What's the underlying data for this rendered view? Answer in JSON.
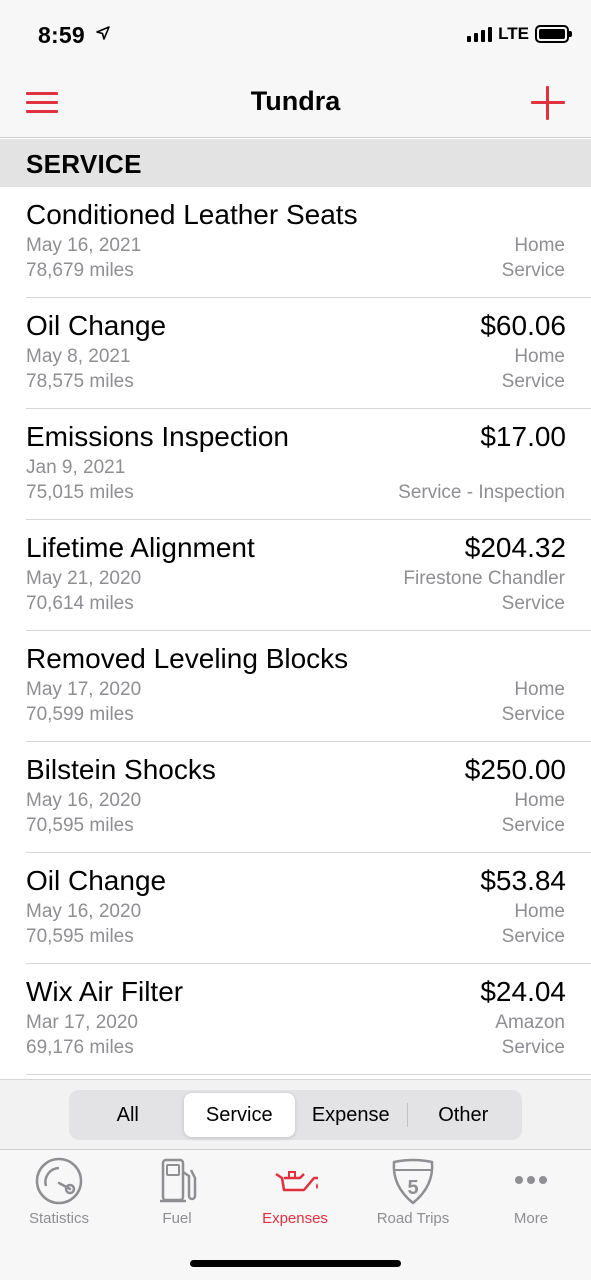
{
  "status_bar": {
    "time": "8:59",
    "network": "LTE"
  },
  "nav": {
    "title": "Tundra",
    "menu_icon": "hamburger-menu-icon",
    "add_icon": "plus-icon",
    "accent_color": "#e0313f"
  },
  "section": {
    "title": "SERVICE"
  },
  "entries": [
    {
      "title": "Conditioned Leather Seats",
      "date": "May 16, 2021",
      "miles": "78,679 miles",
      "amount": "",
      "location": "Home",
      "type": "Service"
    },
    {
      "title": "Oil Change",
      "date": "May 8, 2021",
      "miles": "78,575 miles",
      "amount": "$60.06",
      "location": "Home",
      "type": "Service"
    },
    {
      "title": "Emissions Inspection",
      "date": "Jan 9, 2021",
      "miles": "75,015 miles",
      "amount": "$17.00",
      "location": "",
      "type": "Service - Inspection"
    },
    {
      "title": "Lifetime Alignment",
      "date": "May 21, 2020",
      "miles": "70,614 miles",
      "amount": "$204.32",
      "location": "Firestone Chandler",
      "type": "Service"
    },
    {
      "title": "Removed Leveling Blocks",
      "date": "May 17, 2020",
      "miles": "70,599 miles",
      "amount": "",
      "location": "Home",
      "type": "Service"
    },
    {
      "title": "Bilstein Shocks",
      "date": "May 16, 2020",
      "miles": "70,595 miles",
      "amount": "$250.00",
      "location": "Home",
      "type": "Service"
    },
    {
      "title": "Oil Change",
      "date": "May 16, 2020",
      "miles": "70,595 miles",
      "amount": "$53.84",
      "location": "Home",
      "type": "Service"
    },
    {
      "title": "Wix Air Filter",
      "date": "Mar 17, 2020",
      "miles": "69,176 miles",
      "amount": "$24.04",
      "location": "Amazon",
      "type": "Service"
    }
  ],
  "segments": {
    "items": [
      "All",
      "Service",
      "Expense",
      "Other"
    ],
    "selected": "Service"
  },
  "tabs": [
    {
      "label": "Statistics",
      "icon": "gauge-icon",
      "active": false
    },
    {
      "label": "Fuel",
      "icon": "fuel-pump-icon",
      "active": false
    },
    {
      "label": "Expenses",
      "icon": "oil-can-icon",
      "active": true
    },
    {
      "label": "Road Trips",
      "icon": "interstate-shield-icon",
      "active": false
    },
    {
      "label": "More",
      "icon": "more-dots-icon",
      "active": false
    }
  ],
  "road_trips_shield_number": "5"
}
